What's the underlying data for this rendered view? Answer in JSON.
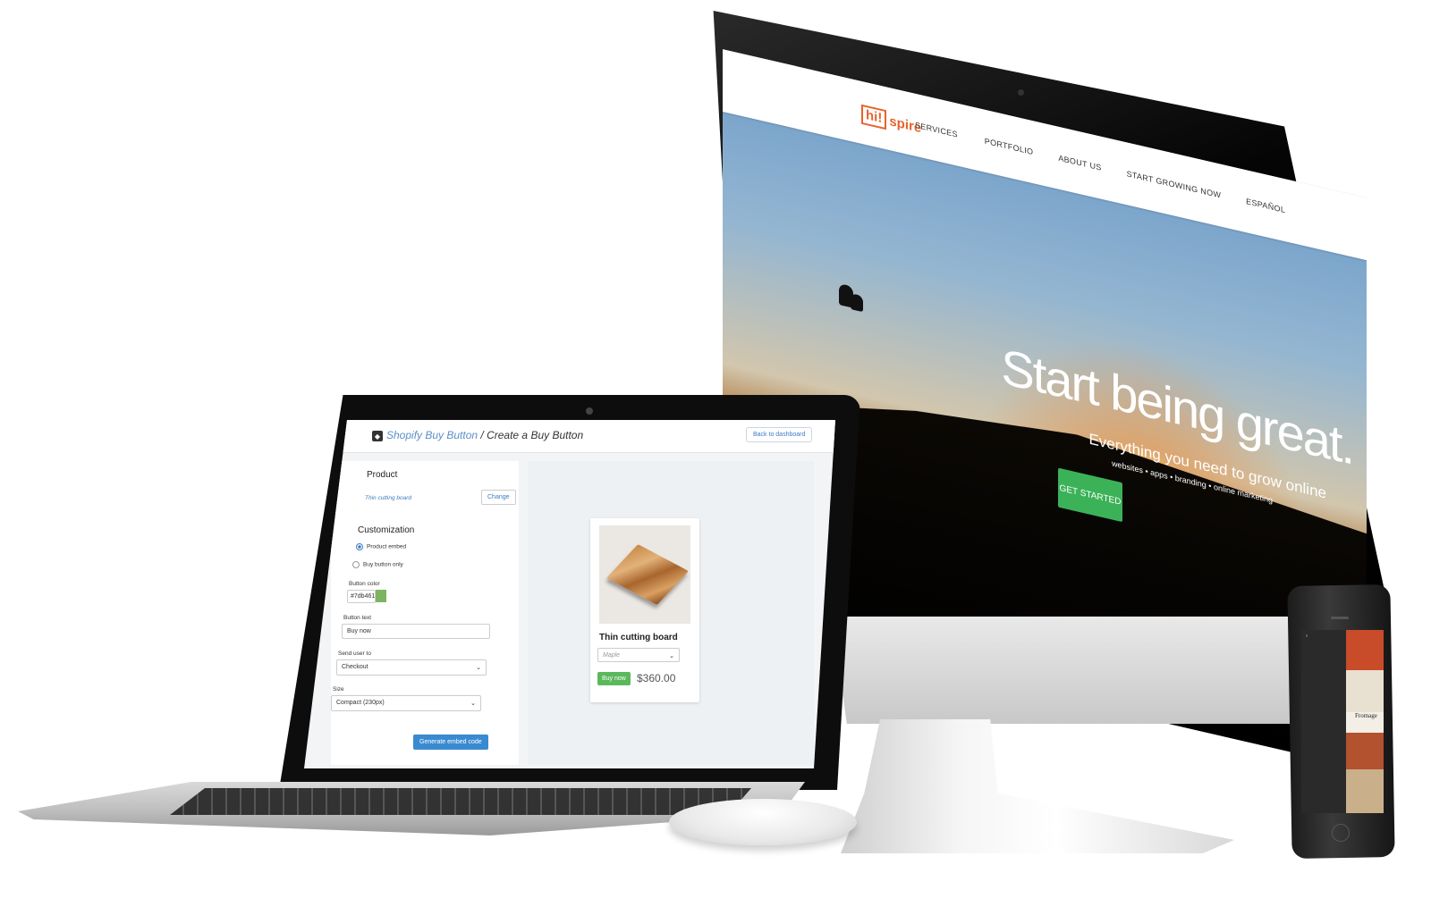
{
  "website": {
    "logo": {
      "box": "hi!",
      "text": "spire"
    },
    "nav": [
      "SERVICES",
      "PORTFOLIO",
      "ABOUT US",
      "START GROWING NOW",
      "ESPAÑOL"
    ],
    "hero_title": "Start being great.",
    "hero_subtitle": "Everything you need to grow online",
    "hero_tagline": "websites • apps • branding • online marketing",
    "cta": "GET STARTED"
  },
  "app": {
    "breadcrumb_link": "Shopify Buy Button",
    "breadcrumb_rest": " / Create a Buy Button",
    "back_button": "Back to dashboard",
    "product_heading": "Product",
    "product_name": "Thin cutting board",
    "change_button": "Change",
    "customization_heading": "Customization",
    "radio_embed": "Product embed",
    "radio_buy_only": "Buy button only",
    "button_color_label": "Button color",
    "button_color_value": "#7db461",
    "button_text_label": "Button text",
    "button_text_value": "Buy now",
    "send_user_label": "Send user to",
    "send_user_value": "Checkout",
    "size_label": "Size",
    "size_value": "Compact (230px)",
    "generate_button": "Generate embed code"
  },
  "preview_card": {
    "title": "Thin cutting board",
    "variant": "Maple",
    "buy_label": "Buy now",
    "price": "$360.00"
  },
  "phone": {
    "title": "Fromage"
  },
  "colors": {
    "brand_orange": "#e8632c",
    "cta_green": "#3bb257",
    "button_color": "#7db461",
    "generate_blue": "#3a8ad1"
  }
}
